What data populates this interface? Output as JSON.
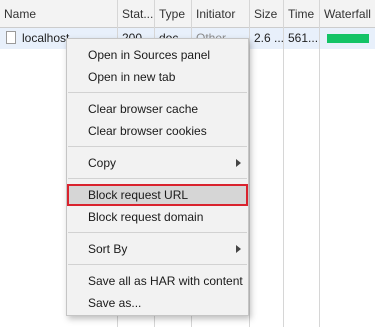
{
  "table": {
    "columns": [
      "Name",
      "Stat...",
      "Type",
      "Initiator",
      "Size",
      "Time",
      "Waterfall"
    ],
    "row": {
      "name": "localhost",
      "status": "200",
      "type": "doc",
      "initiator": "Other",
      "size": "2.6 ...",
      "time": "561...",
      "waterfall_color": "#13c366"
    }
  },
  "context_menu": {
    "items": [
      "Open in Sources panel",
      "Open in new tab",
      "Clear browser cache",
      "Clear browser cookies",
      "Copy",
      "Block request URL",
      "Block request domain",
      "Sort By",
      "Save all as HAR with content",
      "Save as..."
    ],
    "highlighted_item": "Block request URL",
    "highlight_border_color": "#d9232e"
  }
}
